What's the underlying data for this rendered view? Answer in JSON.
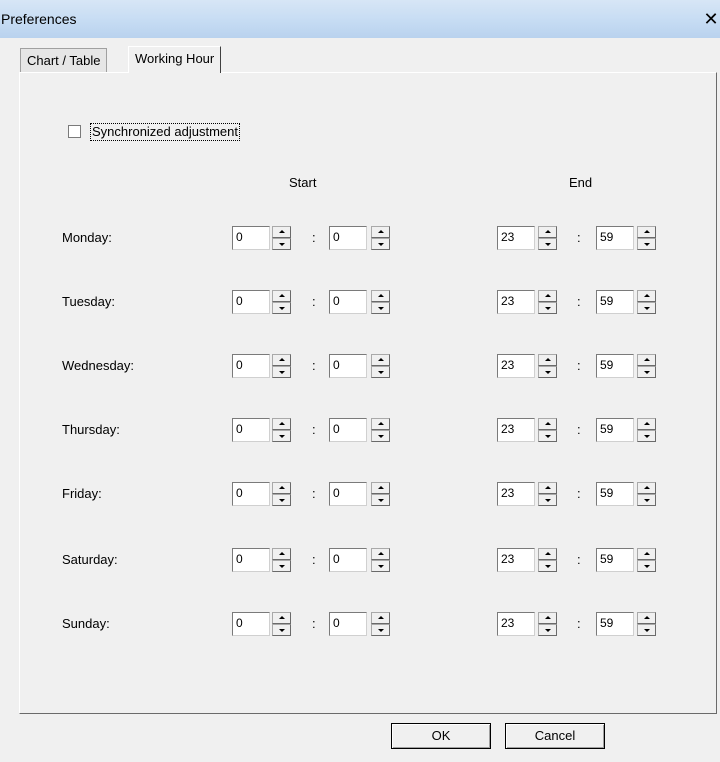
{
  "window": {
    "title": "Preferences",
    "close_glyph": "✕"
  },
  "tabs": [
    {
      "label": "Chart / Table",
      "active": false
    },
    {
      "label": "Working Hour",
      "active": true
    }
  ],
  "panel": {
    "sync_label": "Synchronized adjustment",
    "sync_checked": false,
    "start_header": "Start",
    "end_header": "End",
    "colon": ":",
    "days": [
      {
        "label": "Monday:",
        "start_h": "0",
        "start_m": "0",
        "end_h": "23",
        "end_m": "59"
      },
      {
        "label": "Tuesday:",
        "start_h": "0",
        "start_m": "0",
        "end_h": "23",
        "end_m": "59"
      },
      {
        "label": "Wednesday:",
        "start_h": "0",
        "start_m": "0",
        "end_h": "23",
        "end_m": "59"
      },
      {
        "label": "Thursday:",
        "start_h": "0",
        "start_m": "0",
        "end_h": "23",
        "end_m": "59"
      },
      {
        "label": "Friday:",
        "start_h": "0",
        "start_m": "0",
        "end_h": "23",
        "end_m": "59"
      },
      {
        "label": "Saturday:",
        "start_h": "0",
        "start_m": "0",
        "end_h": "23",
        "end_m": "59"
      },
      {
        "label": "Sunday:",
        "start_h": "0",
        "start_m": "0",
        "end_h": "23",
        "end_m": "59"
      }
    ]
  },
  "buttons": {
    "ok": "OK",
    "cancel": "Cancel"
  }
}
